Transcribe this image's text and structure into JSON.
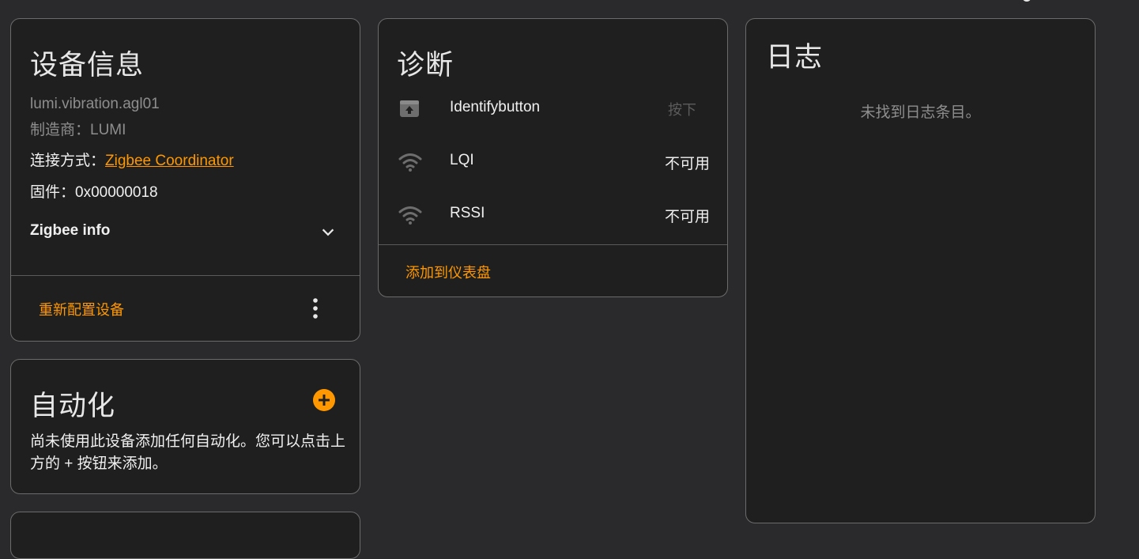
{
  "device_info": {
    "title": "设备信息",
    "model": "lumi.vibration.agl01",
    "manufacturer": "制造商：LUMI",
    "connection_label": "连接方式：",
    "connection_link": "Zigbee Coordinator",
    "firmware": "固件：0x00000018",
    "zigbee_info": "Zigbee info",
    "reconfigure_button": "重新配置设备"
  },
  "automation": {
    "title": "自动化",
    "description": "尚未使用此设备添加任何自动化。您可以点击上方的 + 按钮来添加。"
  },
  "diagnostics": {
    "title": "诊断",
    "rows": [
      {
        "icon": "identify-button-icon",
        "label": "Identifybutton",
        "value": "按下"
      },
      {
        "icon": "wifi-signal-icon",
        "label": "LQI",
        "value": "不可用"
      },
      {
        "icon": "wifi-signal-icon",
        "label": "RSSI",
        "value": "不可用"
      }
    ],
    "add_to_dashboard": "添加到仪表盘"
  },
  "logbook": {
    "title": "日志",
    "empty_message": "未找到日志条目。"
  },
  "colors": {
    "accent": "#ff9800",
    "card_bg": "#1f1f1f",
    "page_bg": "#2a2a2c"
  }
}
